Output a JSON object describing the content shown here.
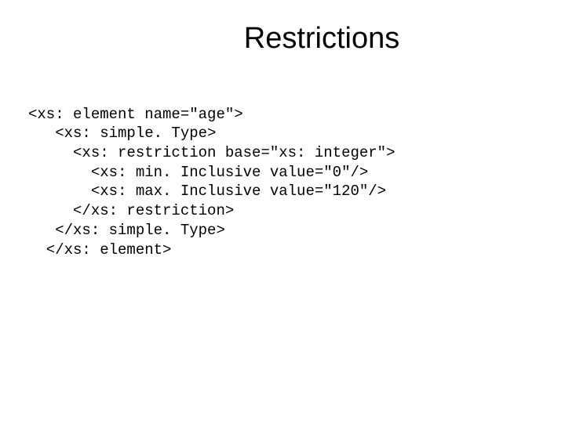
{
  "title": "Restrictions",
  "code": {
    "line1": "<xs: element name=\"age\">",
    "line2": "   <xs: simple. Type>",
    "line3": "     <xs: restriction base=\"xs: integer\">",
    "line4": "       <xs: min. Inclusive value=\"0\"/>",
    "line5": "       <xs: max. Inclusive value=\"120\"/>",
    "line6": "     </xs: restriction>",
    "line7": "   </xs: simple. Type>",
    "line8": "  </xs: element>"
  }
}
